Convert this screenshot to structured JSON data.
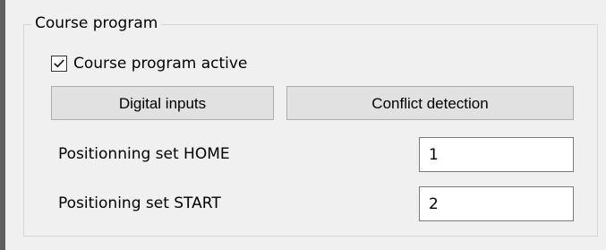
{
  "group": {
    "title": "Course program",
    "checkbox": {
      "label": "Course program active",
      "checked": true
    },
    "buttons": {
      "digital_inputs": "Digital inputs",
      "conflict_detection": "Conflict detection"
    },
    "fields": {
      "home": {
        "label": "Positionning set HOME",
        "value": "1"
      },
      "start": {
        "label": "Positioning set START",
        "value": "2"
      }
    }
  },
  "colors": {
    "background": "#f0f0f0",
    "group_border": "#d6d6d6",
    "button_background": "#e1e1e1",
    "button_border": "#adadad",
    "field_border": "#7a7a7a",
    "left_edge": "#5f5f5f"
  },
  "icons": {
    "checkbox_mark": "check-mark-icon"
  }
}
